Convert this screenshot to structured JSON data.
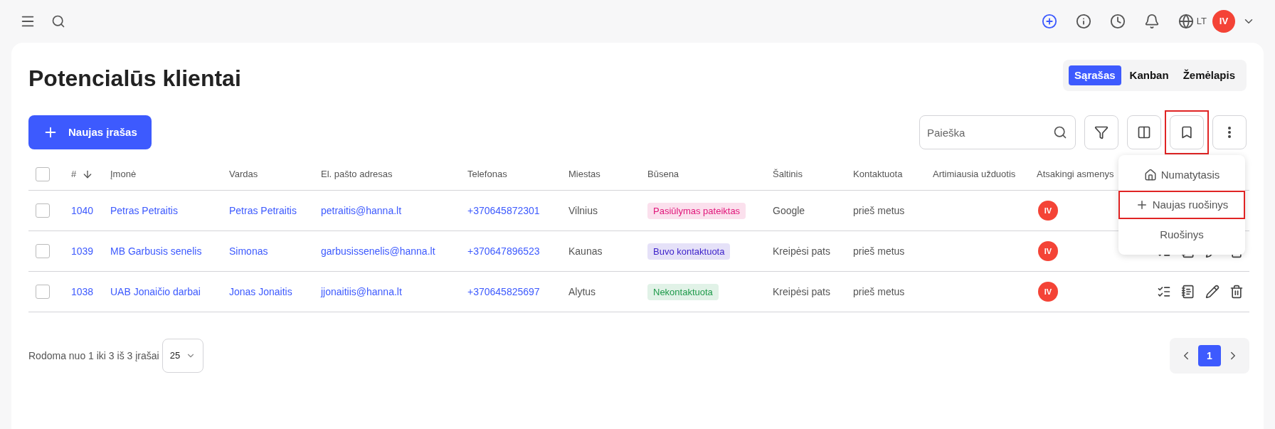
{
  "topbar": {
    "language": "LT",
    "avatar": "IV"
  },
  "title": "Potencialūs klientai",
  "view_tabs": [
    {
      "label": "Sąrašas",
      "selected": true
    },
    {
      "label": "Kanban",
      "selected": false
    },
    {
      "label": "Žemėlapis",
      "selected": false
    }
  ],
  "new_button": "Naujas įrašas",
  "search": {
    "placeholder": "Paieška"
  },
  "toolbar": [
    {
      "kind": "filter",
      "highlighted": false
    },
    {
      "kind": "columns",
      "highlighted": false
    },
    {
      "kind": "bookmark",
      "highlighted": true
    },
    {
      "kind": "more",
      "highlighted": false
    }
  ],
  "menu": [
    {
      "kind": "home",
      "label": "Numatytasis",
      "highlighted": false
    },
    {
      "kind": "add",
      "label": "Naujas ruošinys",
      "highlighted": true
    },
    {
      "kind": "plain",
      "label": "Ruošinys",
      "highlighted": false
    }
  ],
  "table": {
    "columns": [
      {
        "label": "#",
        "sorted": true
      },
      {
        "label": "Įmonė",
        "sorted": false
      },
      {
        "label": "Vardas",
        "sorted": false
      },
      {
        "label": "El. pašto adresas",
        "sorted": false
      },
      {
        "label": "Telefonas",
        "sorted": false
      },
      {
        "label": "Miestas",
        "sorted": false
      },
      {
        "label": "Būsena",
        "sorted": false
      },
      {
        "label": "Šaltinis",
        "sorted": false
      },
      {
        "label": "Kontaktuota",
        "sorted": false
      },
      {
        "label": "Artimiausia užduotis",
        "sorted": false
      },
      {
        "label": "Atsakingi asmenys",
        "sorted": false
      }
    ],
    "rows": [
      {
        "id": "1040",
        "company": "Petras Petraitis",
        "name": "Petras Petraitis",
        "email": "petraitis@hanna.lt",
        "phone": "+370645872301",
        "city": "Vilnius",
        "status": {
          "label": "Pasiūlymas pateiktas",
          "color": "#e0167a"
        },
        "source": "Google",
        "contacted": "prieš metus",
        "assignee": "IV",
        "checked": false
      },
      {
        "id": "1039",
        "company": "MB Garbusis senelis",
        "name": "Simonas",
        "email": "garbusissenelis@hanna.lt",
        "phone": "+370647896523",
        "city": "Kaunas",
        "status": {
          "label": "Buvo kontaktuota",
          "color": "#3b1fc9"
        },
        "source": "Kreipėsi pats",
        "contacted": "prieš metus",
        "assignee": "IV",
        "checked": false
      },
      {
        "id": "1038",
        "company": "UAB Jonaičio darbai",
        "name": "Jonas Jonaitis",
        "email": "jjonaitiis@hanna.lt",
        "phone": "+370645825697",
        "city": "Alytus",
        "status": {
          "label": "Nekontaktuota",
          "color": "#1e9a4a"
        },
        "source": "Kreipėsi pats",
        "contacted": "prieš metus",
        "assignee": "IV",
        "checked": false
      }
    ]
  },
  "select_all": {
    "checked": false
  },
  "footer": {
    "summary": "Rodoma nuo 1 iki 3 iš 3 įrašai",
    "page_size": "25"
  },
  "pagination": [
    {
      "label": "1",
      "selected": true
    }
  ]
}
